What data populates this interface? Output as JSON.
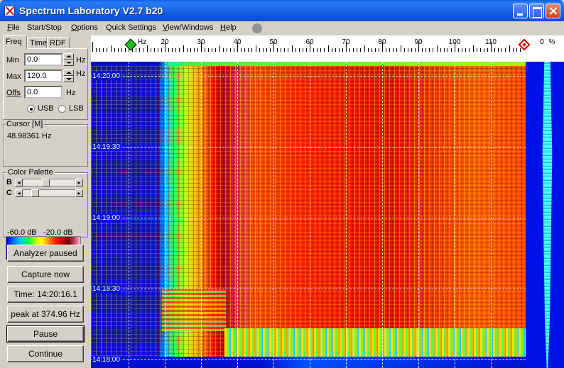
{
  "window": {
    "title": "Spectrum Laboratory V2.7 b20"
  },
  "menu": {
    "file": "File",
    "start_stop": "Start/Stop",
    "options": "Options",
    "quick_settings": "Quick Settings",
    "view_windows": "View/Windows",
    "help": "Help"
  },
  "tabs": {
    "freq": "Freq",
    "time": "Time",
    "rdf": "RDF"
  },
  "freq_panel": {
    "min_label": "Min",
    "min_value": "0.0",
    "min_unit": "Hz",
    "max_label": "Max",
    "max_value": "120.0",
    "max_unit": "Hz",
    "offs_label": "Offs",
    "offs_value": "0.0",
    "offs_unit": "Hz",
    "usb_label": "USB",
    "lsb_label": "LSB",
    "selected_sideband": "USB"
  },
  "cursor": {
    "title": "Cursor  [M]",
    "value": "48.98361 Hz"
  },
  "palette": {
    "title": "Color Palette",
    "b_label": "B",
    "c_label": "C",
    "min_db": "-60.0 dB",
    "max_db": "-20.0 dB"
  },
  "buttons": {
    "analyzer_paused": "Analyzer paused",
    "capture_now": "Capture now",
    "time": "Time:  14:20:16.1",
    "peak": "peak at 374.96 Hz",
    "pause": "Pause",
    "continue": "Continue"
  },
  "scale": {
    "unit": "Hz",
    "ticks": [
      "10",
      "20",
      "30",
      "40",
      "50",
      "60",
      "70",
      "80",
      "90",
      "100",
      "110"
    ],
    "percent_zero": "0",
    "percent_unit": "%"
  },
  "waterfall": {
    "time_labels": [
      "14:20:00",
      "14:19:30",
      "14:19:00",
      "14:18:30",
      "14:18:00"
    ]
  },
  "colors": {
    "title_bar": "#0b4bd3",
    "waterfall_background": "#0010d0",
    "spectrum_trace": "#30f0f0"
  }
}
